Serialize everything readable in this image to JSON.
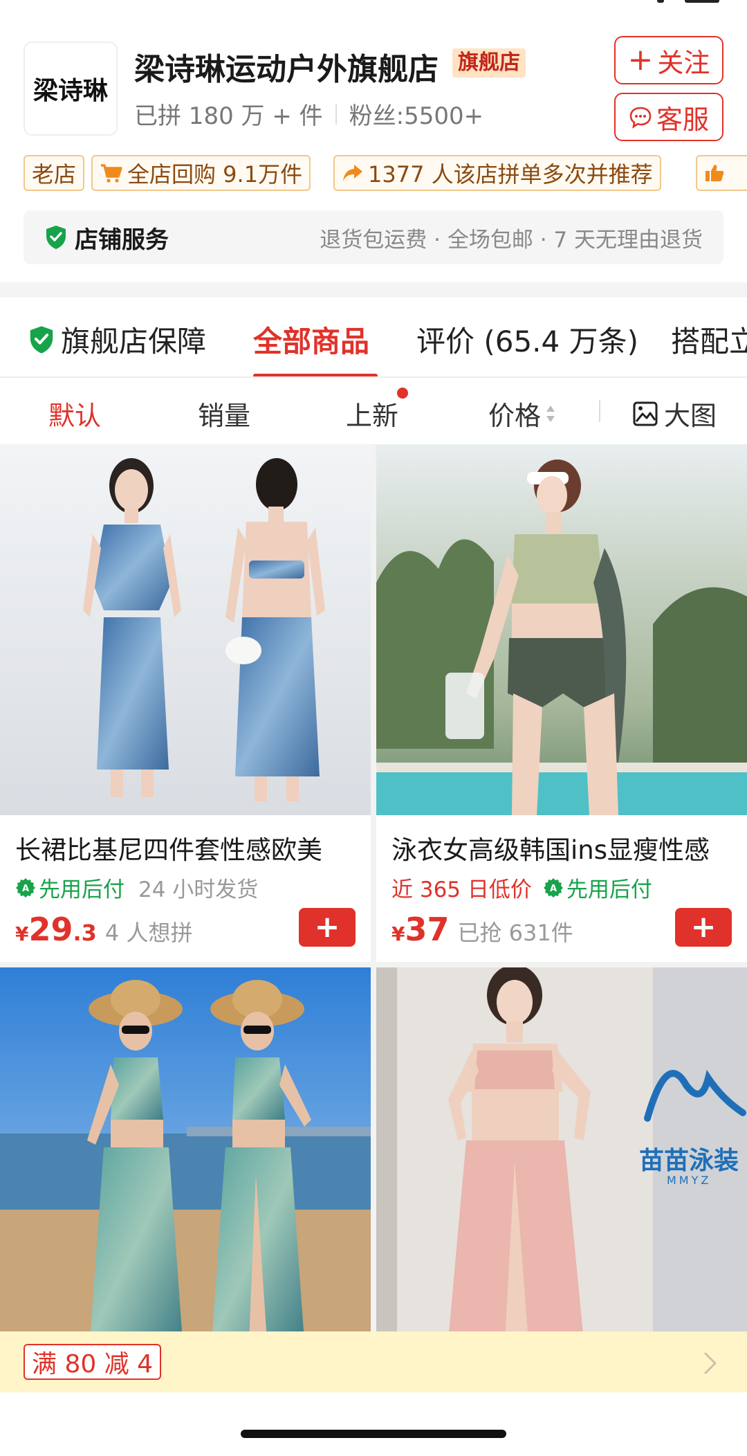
{
  "store": {
    "logo_text": "梁诗琳",
    "name": "梁诗琳运动户外旗舰店",
    "flagship_badge": "旗舰店",
    "stat_sold": "已拼 180 万 + 件",
    "stat_fans": "粉丝:5500+",
    "follow_label": "关注",
    "service_label": "客服"
  },
  "tags": [
    {
      "text": "老店",
      "icon": "none"
    },
    {
      "text": "全店回购 9.1万件",
      "icon": "cart-icon"
    },
    {
      "text": "1377 人该店拼单多次并推荐",
      "icon": "share-arrow-icon"
    },
    {
      "text": "",
      "icon": "thumbs-up-icon"
    }
  ],
  "service": {
    "title": "店铺服务",
    "items": "退货包运费 · 全场包邮 · 7 天无理由退货"
  },
  "tabs": [
    {
      "label": "旗舰店保障",
      "active": false
    },
    {
      "label": "全部商品",
      "active": true
    },
    {
      "label": "评价 (65.4 万条)",
      "active": false
    },
    {
      "label": "搭配立",
      "active": false
    }
  ],
  "sort": {
    "default": "默认",
    "sales": "销量",
    "new": "上新",
    "price": "价格",
    "big_image": "大图"
  },
  "products": [
    {
      "name": "长裙比基尼四件套性感欧美",
      "badge_low": "",
      "paylater": "先用后付",
      "note": "24 小时发货",
      "currency": "¥",
      "price_int": "29",
      "price_dec": ".3",
      "sold": "4 人想拼",
      "add": "+"
    },
    {
      "name": "泳衣女高级韩国ins显瘦性感",
      "badge_low": "近 365 日低价",
      "paylater": "先用后付",
      "note": "",
      "currency": "¥",
      "price_int": "37",
      "price_dec": "",
      "sold": "已抢 631件",
      "add": "+"
    },
    {
      "name": "",
      "watermark": ""
    },
    {
      "name": "",
      "watermark": "苗苗泳装",
      "watermark_sub": "MMYZ"
    }
  ],
  "promo": {
    "tag": "满 80 减 4"
  },
  "colors": {
    "brand_red": "#e0322a",
    "paylater_green": "#17a34a",
    "promo_bg": "#fff5c8"
  }
}
